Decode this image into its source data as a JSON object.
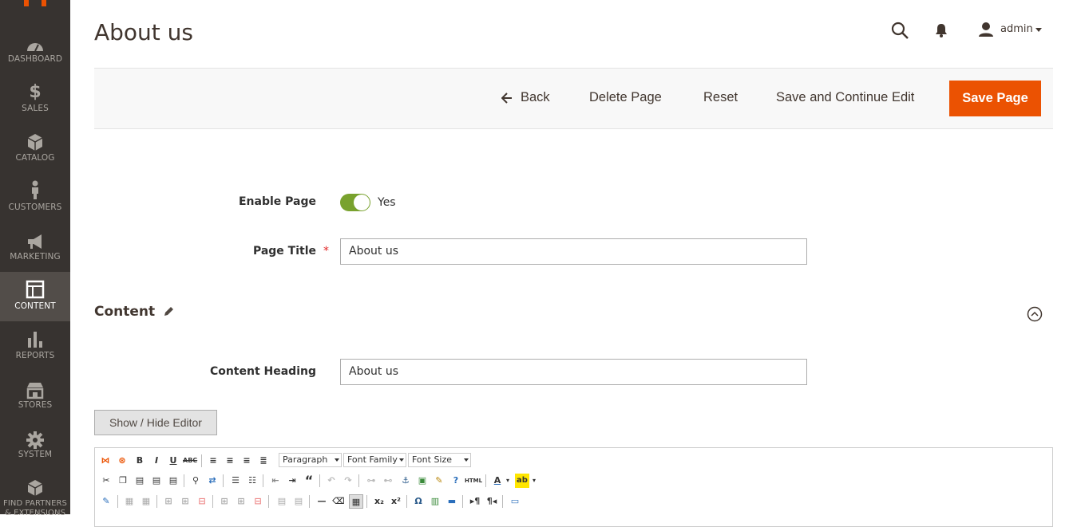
{
  "page": {
    "title": "About us"
  },
  "sidebar": {
    "items": [
      {
        "label": "DASHBOARD",
        "icon": "dashboard-icon"
      },
      {
        "label": "SALES",
        "icon": "dollar-icon"
      },
      {
        "label": "CATALOG",
        "icon": "box-icon"
      },
      {
        "label": "CUSTOMERS",
        "icon": "person-icon"
      },
      {
        "label": "MARKETING",
        "icon": "megaphone-icon"
      },
      {
        "label": "CONTENT",
        "icon": "layout-icon"
      },
      {
        "label": "REPORTS",
        "icon": "bar-chart-icon"
      },
      {
        "label": "STORES",
        "icon": "store-icon"
      },
      {
        "label": "SYSTEM",
        "icon": "gear-icon"
      },
      {
        "label": "FIND PARTNERS & EXTENSIONS",
        "icon": "cubes-icon"
      }
    ]
  },
  "header": {
    "user": "admin"
  },
  "actions": {
    "back": "Back",
    "delete": "Delete Page",
    "reset": "Reset",
    "save_continue": "Save and Continue Edit",
    "save": "Save Page"
  },
  "form": {
    "enable_label": "Enable Page",
    "enable_value": "Yes",
    "title_label": "Page Title",
    "title_value": "About us"
  },
  "content": {
    "section_title": "Content",
    "heading_label": "Content Heading",
    "heading_value": "About us",
    "toggle_editor": "Show / Hide Editor"
  },
  "editor": {
    "format_select": "Paragraph",
    "font_family_select": "Font Family",
    "font_size_select": "Font Size"
  },
  "colors": {
    "accent": "#eb5202",
    "sidebar": "#373330",
    "toggle_on": "#79a22e"
  }
}
